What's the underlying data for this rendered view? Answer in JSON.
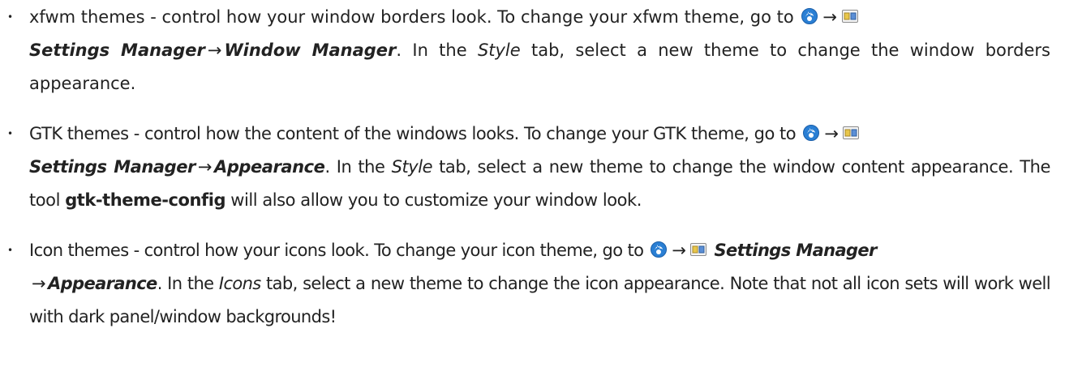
{
  "icons": {
    "menu": "xfce-menu-icon",
    "settings": "settings-manager-icon"
  },
  "colors": {
    "text": "#222222",
    "menu_icon_blue": "#2a7fd4",
    "settings_icon_fill": "#e8c64a"
  },
  "items": [
    {
      "lead": "xfwm themes - control how your window borders look. To change your xfwm theme, go to",
      "arrow1": "→",
      "menu_path_1": "Settings Manager",
      "arrow2": "→",
      "menu_path_2": "Window Manager",
      "mid1": ". In the",
      "tab_name": "Style",
      "tail": "tab, select a new theme to change the window borders appearance."
    },
    {
      "lead": "GTK themes - control how the content of the windows looks. To change your GTK theme, go to",
      "arrow1": "→",
      "menu_path_1": "Settings Manager",
      "arrow2": "→",
      "menu_path_2": "Appearance",
      "mid1": ". In the",
      "tab_name": "Style",
      "mid2": "tab, select a new theme to change the window content appearance. The tool",
      "tool_name": "gtk-theme-config",
      "tail": "will also allow you to customize your window look."
    },
    {
      "lead": "Icon themes - control how your icons look. To change your icon theme, go to",
      "arrow1": "→",
      "menu_path_1": "Settings Manager",
      "arrow2": "→",
      "menu_path_2": "Appearance",
      "mid1": ". In the",
      "tab_name": "Icons",
      "tail": "tab, select a new theme to change the icon appearance. Note that not all icon sets will work well with dark panel/window backgrounds!"
    }
  ]
}
